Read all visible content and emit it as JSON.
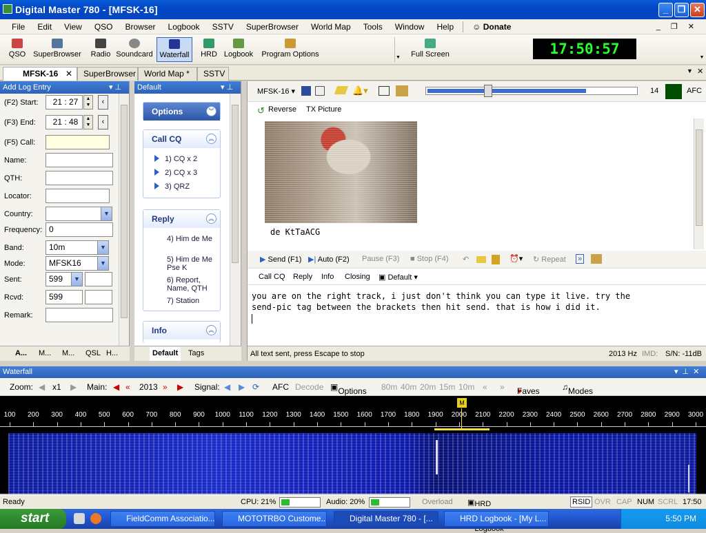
{
  "window": {
    "title": "Digital Master 780 - [MFSK-16]"
  },
  "menu": [
    "File",
    "Edit",
    "View",
    "QSO",
    "Browser",
    "Logbook",
    "SSTV",
    "SuperBrowser",
    "World Map",
    "Tools",
    "Window",
    "Help"
  ],
  "donate": "Donate",
  "toolbar": {
    "qso": "QSO",
    "superbrowser": "SuperBrowser",
    "radio": "Radio",
    "soundcard": "Soundcard",
    "waterfall": "Waterfall",
    "hrd": "HRD",
    "logbook": "Logbook",
    "program_options": "Program Options",
    "full_screen": "Full Screen"
  },
  "clock": "17:50:57",
  "tabs": [
    "MFSK-16",
    "SuperBrowser",
    "World Map *",
    "SSTV"
  ],
  "log": {
    "title": "Add Log Entry",
    "start_label": "(F2) Start:",
    "start": "21 : 27",
    "end_label": "(F3) End:",
    "end": "21 : 48",
    "call_label": "(F5) Call:",
    "name_label": "Name:",
    "qth_label": "QTH:",
    "locator_label": "Locator:",
    "country_label": "Country:",
    "frequency_label": "Frequency:",
    "frequency": "0",
    "band_label": "Band:",
    "band": "10m",
    "mode_label": "Mode:",
    "mode": "MFSK16",
    "sent_label": "Sent:",
    "sent": "599",
    "rcvd_label": "Rcvd:",
    "rcvd": "599",
    "remark_label": "Remark:",
    "bottom_tabs": [
      "A...",
      "M...",
      "M...",
      "QSL",
      "H..."
    ]
  },
  "default_panel": {
    "title": "Default",
    "options": "Options",
    "callcq": "Call CQ",
    "cq_items": [
      "1)  CQ x 2",
      "2)  CQ x 3",
      "3)  QRZ"
    ],
    "reply": "Reply",
    "reply_items": [
      "4)  Him de Me",
      "5)  Him de Me Pse K",
      "6)  Report, Name, QTH",
      "7)  Station"
    ],
    "info": "Info",
    "bottom_tabs": [
      "Default",
      "Tags"
    ]
  },
  "main": {
    "mode": "MFSK-16",
    "afc_num": "14",
    "afc": "AFC",
    "reverse": "Reverse",
    "tx_picture": "TX Picture",
    "rx_text": "de KtTaACG",
    "send": "Send (F1)",
    "auto": "Auto (F2)",
    "pause": "Pause (F3)",
    "stop": "Stop (F4)",
    "repeat": "Repeat",
    "macros": [
      "Call CQ",
      "Reply",
      "Info",
      "Closing"
    ],
    "macro_default": "Default",
    "tx_line1": "you are on the right track, i just don't think you can type it live.  try the",
    "tx_line2": "send-pic tag between the brackets then hit send.  that is how i did it.",
    "status": "All text sent, press Escape to stop",
    "freq": "2013 Hz",
    "imd": "IMD:",
    "sn": "S/N: -11dB"
  },
  "waterfall": {
    "title": "Waterfall",
    "zoom_label": "Zoom:",
    "zoom": "x1",
    "main_label": "Main:",
    "main_freq": "2013",
    "signal_label": "Signal:",
    "afc": "AFC",
    "decode": "Decode",
    "options": "Options",
    "bands": [
      "80m",
      "40m",
      "20m",
      "15m",
      "10m"
    ],
    "faves": "Faves",
    "modes": "Modes",
    "scale": [
      "100",
      "200",
      "300",
      "400",
      "500",
      "600",
      "700",
      "800",
      "900",
      "1000",
      "1100",
      "1200",
      "1300",
      "1400",
      "1500",
      "1600",
      "1700",
      "1800",
      "1900",
      "2000",
      "2100",
      "2200",
      "2300",
      "2400",
      "2500",
      "2600",
      "2700",
      "2800",
      "2900",
      "3000"
    ]
  },
  "statusbar": {
    "ready": "Ready",
    "cpu": "CPU: 21%",
    "audio": "Audio: 20%",
    "overload": "Overload",
    "hrd": "HRD Logbook: My Logbook",
    "rsid": "RSID",
    "ovr": "OVR",
    "cap": "CAP",
    "num": "NUM",
    "scrl": "SCRL",
    "time": "17:50"
  },
  "taskbar": {
    "start": "start",
    "tasks": [
      "FieldComm Associatio...",
      "MOTOTRBO Custome...",
      "Digital Master 780 - [...",
      "HRD Logbook - [My L..."
    ],
    "time": "5:50 PM"
  }
}
